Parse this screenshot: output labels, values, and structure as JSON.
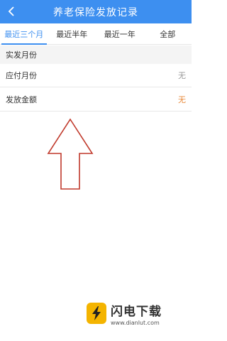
{
  "header": {
    "title": "养老保险发放记录"
  },
  "tabs": [
    {
      "label": "最近三个月",
      "active": true
    },
    {
      "label": "最近半年",
      "active": false
    },
    {
      "label": "最近一年",
      "active": false
    },
    {
      "label": "全部",
      "active": false
    }
  ],
  "section": {
    "label": "实发月份"
  },
  "rows": [
    {
      "label": "应付月份",
      "value": "无"
    },
    {
      "label": "发放金额",
      "value": "无"
    }
  ],
  "watermark": {
    "title": "闪电下载",
    "url": "www.dianlut.com"
  },
  "colors": {
    "primary": "#3d8ff0",
    "accent_orange": "#e8893a",
    "arrow": "#c0392b"
  }
}
